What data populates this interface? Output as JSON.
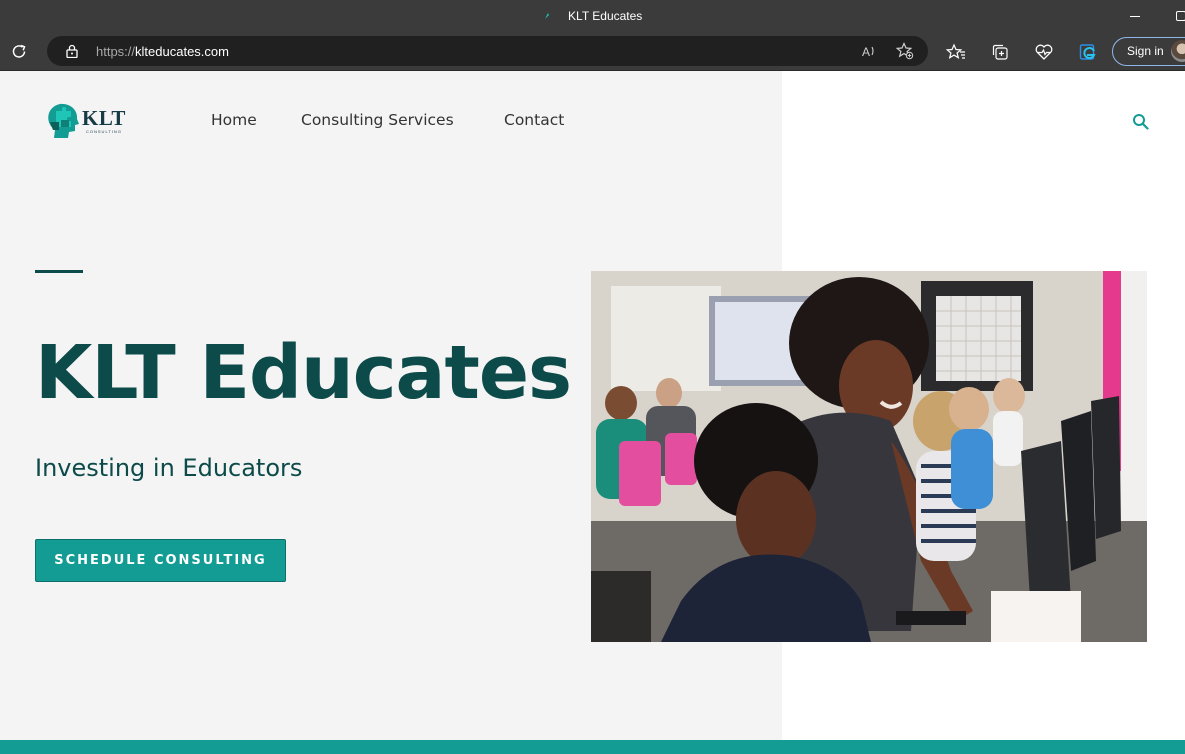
{
  "browser": {
    "tab_title": "KLT Educates",
    "url_scheme": "https://",
    "url_host": "klteducates.com",
    "sign_in_label": "Sign in",
    "icons": [
      "refresh-icon",
      "lock-icon",
      "read-aloud-icon",
      "add-favorite-icon",
      "favorites-icon",
      "collections-icon",
      "browser-essentials-icon",
      "edge-icon"
    ]
  },
  "site": {
    "logo_text": "KLT",
    "logo_subtext": "CONSULTING",
    "nav": {
      "home": "Home",
      "consulting": "Consulting Services",
      "contact": "Contact"
    },
    "hero": {
      "title": "KLT Educates",
      "subtitle": "Investing in Educators",
      "cta_label": "SCHEDULE CONSULTING"
    },
    "colors": {
      "brand_teal": "#139c93",
      "heading": "#0d4a4a",
      "panel_bg": "#f4f4f4"
    }
  }
}
